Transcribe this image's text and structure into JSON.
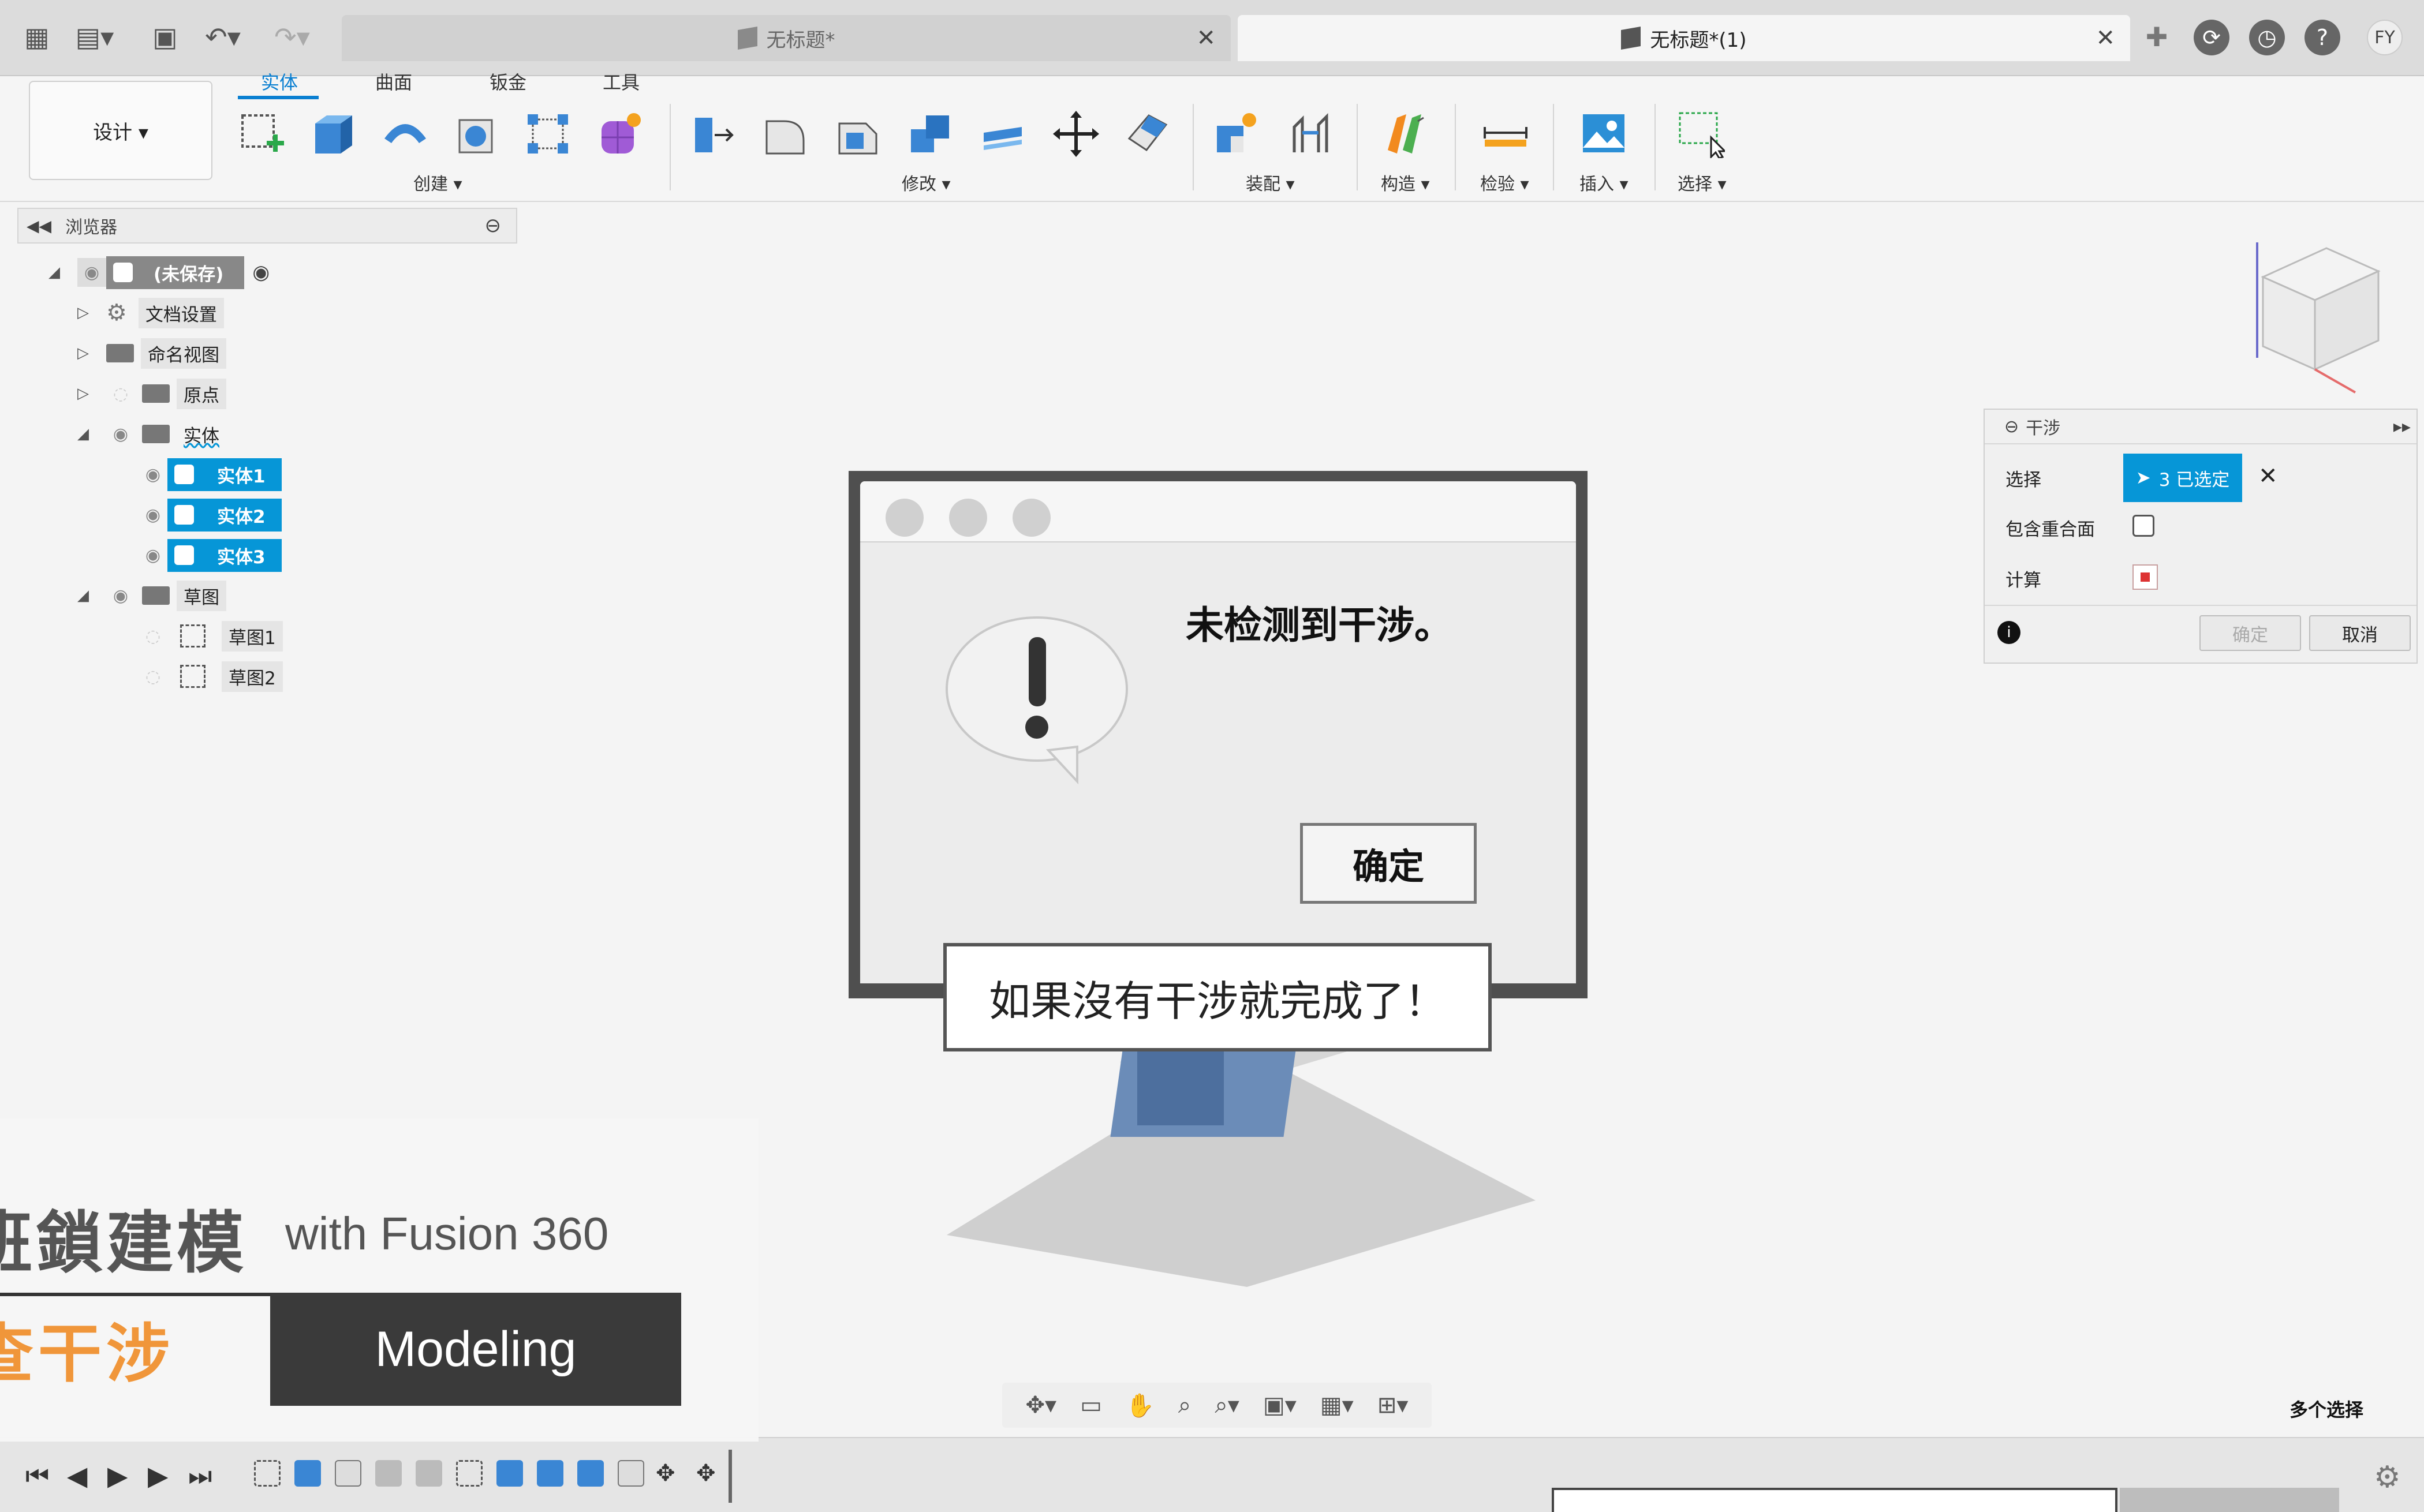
{
  "tabs": [
    {
      "label": "无标题*",
      "active": false
    },
    {
      "label": "无标题*(1)",
      "active": true
    }
  ],
  "user_initials": "FY",
  "workspace_button": "设计 ▾",
  "ribbon_tabs": [
    "实体",
    "曲面",
    "钣金",
    "工具"
  ],
  "ribbon_groups": [
    "创建 ▾",
    "修改 ▾",
    "装配 ▾",
    "构造 ▾",
    "检验 ▾",
    "插入 ▾",
    "选择 ▾"
  ],
  "browser": {
    "title": "浏览器",
    "root": "(未保存)",
    "doc_settings": "文档设置",
    "named_views": "命名视图",
    "origin": "原点",
    "bodies": "实体",
    "body_items": [
      "实体1",
      "实体2",
      "实体3"
    ],
    "sketches": "草图",
    "sketch_items": [
      "草图1",
      "草图2"
    ]
  },
  "interference_panel": {
    "title": "干涉",
    "select_label": "选择",
    "select_value": "3 已选定",
    "include_coincident_label": "包含重合面",
    "compute_label": "计算",
    "ok_label": "确定",
    "cancel_label": "取消"
  },
  "alert_dialog": {
    "message": "未检测到干涉。",
    "ok_label": "确定"
  },
  "caption": "如果沒有干涉就完成了！",
  "status": {
    "multi_select": "多个选择"
  },
  "brand_overlay": {
    "title": "班鎖建模",
    "subtitle": "with Fusion 360",
    "topic": "查干涉",
    "badge": "Modeling"
  },
  "colors": {
    "accent": "#0696d7",
    "orange": "#f0963a",
    "dark": "#3a3a3a"
  }
}
